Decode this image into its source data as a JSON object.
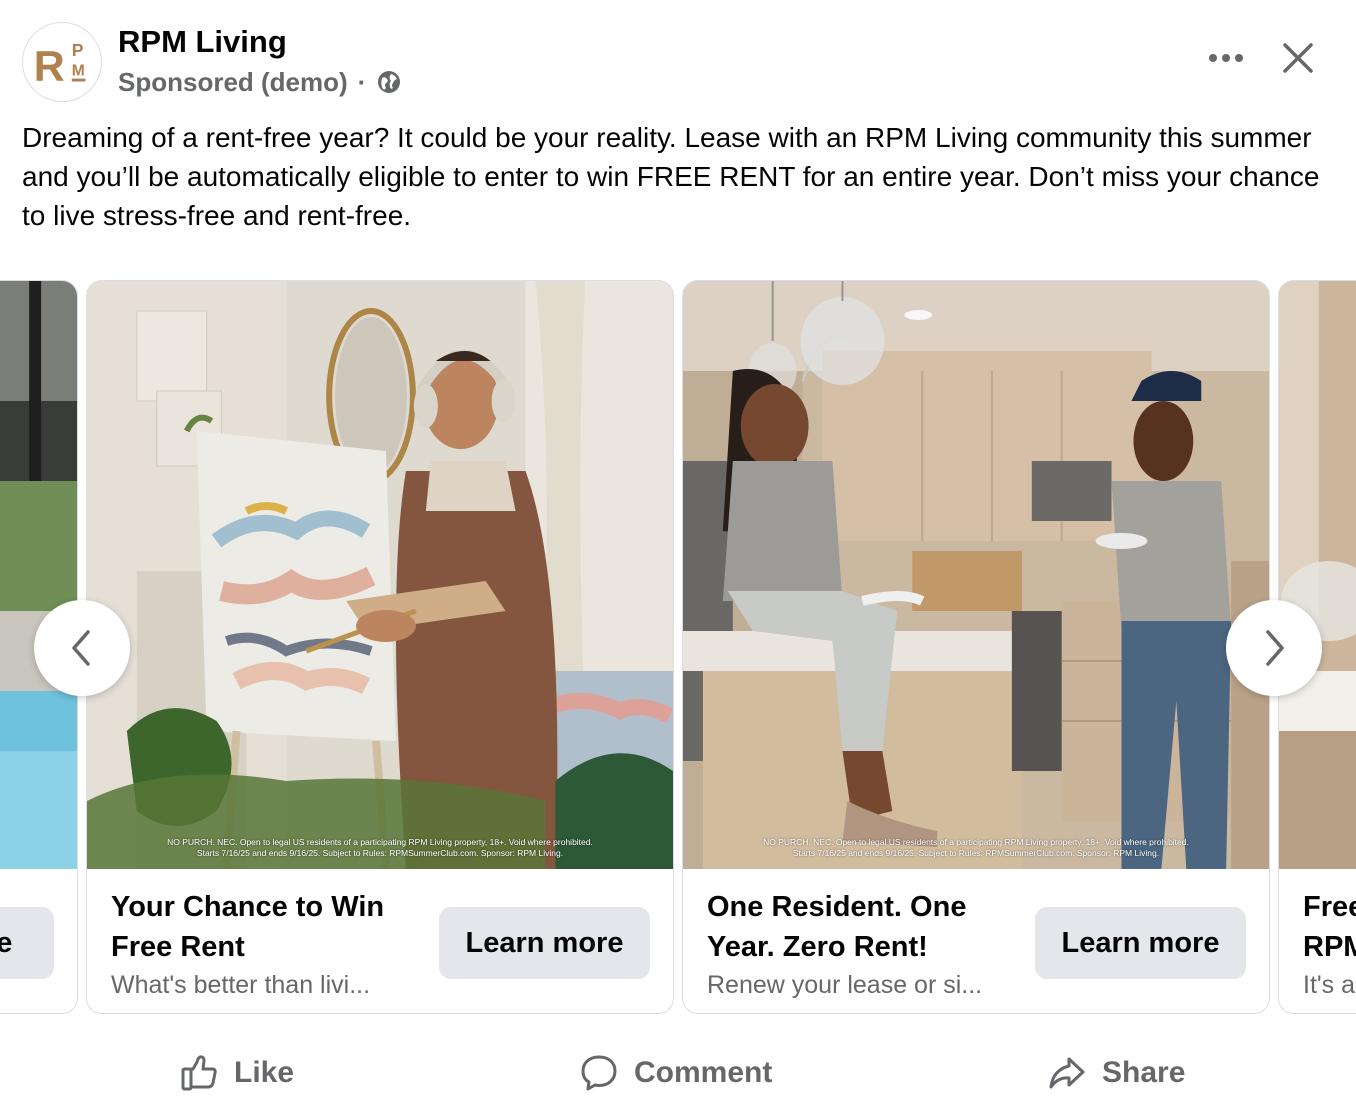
{
  "header": {
    "page_name": "RPM Living",
    "sponsored": "Sponsored (demo)",
    "separator": "·",
    "logo_text": "R",
    "logo_small_top": "P",
    "logo_small_bottom": "M",
    "brand_color": "#b0804f"
  },
  "post": {
    "text": "Dreaming of a rent-free year? It could be your reality. Lease with an RPM Living community this summer and you’ll be automatically eligible to enter to win FREE RENT for an entire year. Don’t miss your chance to live stress-free and rent-free."
  },
  "carousel": {
    "partial_left": {
      "cta_fragment": "re"
    },
    "cards": [
      {
        "title": "Your Chance to Win Free Rent",
        "description": "What's better than livi...",
        "cta": "Learn more",
        "disclaimer_line1": "NO PURCH. NEC. Open to legal US residents of a participating RPM Living property, 18+. Void where prohibited.",
        "disclaimer_line2": "Starts 7/16/25 and ends 9/16/25. Subject to Rules: RPMSummerClub.com. Sponsor: RPM Living."
      },
      {
        "title": "One Resident. One Year. Zero Rent!",
        "description": "Renew your lease or si...",
        "cta": "Learn more",
        "disclaimer_line1": "NO PURCH. NEC. Open to legal US residents of a participating RPM Living property, 18+. Void where prohibited.",
        "disclaimer_line2": "Starts 7/16/25 and ends 9/16/25. Subject to Rules: RPMSummerClub.com. Sponsor: RPM Living."
      }
    ],
    "partial_right": {
      "title_line1": "Free",
      "title_line2": "RPM",
      "desc": "It's a"
    }
  },
  "actions": {
    "like": "Like",
    "comment": "Comment",
    "share": "Share"
  }
}
